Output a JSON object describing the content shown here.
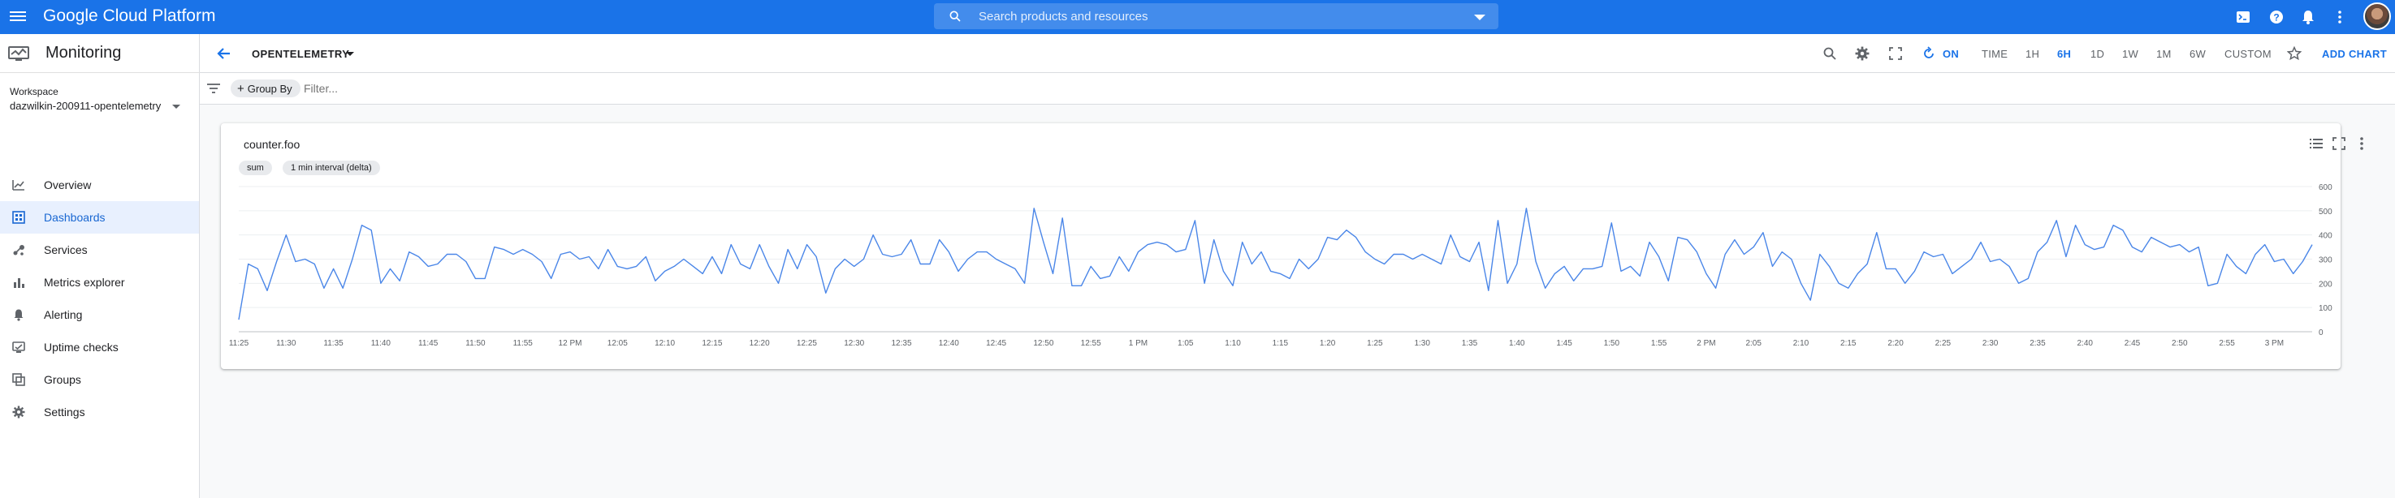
{
  "app": {
    "brand": "Google Cloud Platform"
  },
  "search": {
    "placeholder": "Search products and resources"
  },
  "sidebar": {
    "product": "Monitoring",
    "workspace_label": "Workspace",
    "workspace_value": "dazwilkin-200911-opentelemetry",
    "items": [
      {
        "label": "Overview",
        "icon": "overview-icon",
        "active": false
      },
      {
        "label": "Dashboards",
        "icon": "dashboards-icon",
        "active": true
      },
      {
        "label": "Services",
        "icon": "services-icon",
        "active": false
      },
      {
        "label": "Metrics explorer",
        "icon": "metrics-explorer-icon",
        "active": false
      },
      {
        "label": "Alerting",
        "icon": "bell-icon",
        "active": false
      },
      {
        "label": "Uptime checks",
        "icon": "uptime-icon",
        "active": false
      },
      {
        "label": "Groups",
        "icon": "groups-icon",
        "active": false
      },
      {
        "label": "Settings",
        "icon": "gear-icon",
        "active": false
      }
    ]
  },
  "toolbar": {
    "dashboard_name": "OPENTELEMETRY",
    "auto_refresh": "ON",
    "time_label": "TIME",
    "ranges": [
      "1H",
      "6H",
      "1D",
      "1W",
      "1M",
      "6W"
    ],
    "selected_range": "6H",
    "custom": "CUSTOM",
    "add_chart": "ADD CHART"
  },
  "filters": {
    "group_by": "Group By",
    "placeholder": "Filter..."
  },
  "colors": {
    "brand": "#1a73e8",
    "line": "#4a86e8",
    "active_bg": "#e8f0fe"
  },
  "chart": {
    "title": "counter.foo",
    "chips": [
      "sum",
      "1 min interval (delta)"
    ]
  },
  "chart_data": {
    "type": "line",
    "title": "counter.foo",
    "xlabel": "",
    "ylabel": "",
    "ylim": [
      0,
      600
    ],
    "yticks": [
      0,
      100,
      200,
      300,
      400,
      500,
      600
    ],
    "xticks": [
      "11:25",
      "11:30",
      "11:35",
      "11:40",
      "11:45",
      "11:50",
      "11:55",
      "12 PM",
      "12:05",
      "12:10",
      "12:15",
      "12:20",
      "12:25",
      "12:30",
      "12:35",
      "12:40",
      "12:45",
      "12:50",
      "12:55",
      "1 PM",
      "1:05",
      "1:10",
      "1:15",
      "1:20",
      "1:25",
      "1:30",
      "1:35",
      "1:40",
      "1:45",
      "1:50",
      "1:55",
      "2 PM",
      "2:05",
      "2:10",
      "2:15",
      "2:20",
      "2:25",
      "2:30",
      "2:35",
      "2:40",
      "2:45",
      "2:50",
      "2:55",
      "3 PM"
    ],
    "x_start": "11:25",
    "x_end": "3:00 PM",
    "x_step": "1 min",
    "grid": true,
    "series": [
      {
        "values": [
          50,
          280,
          260,
          170,
          290,
          400,
          290,
          300,
          280,
          180,
          260,
          180,
          300,
          440,
          420,
          200,
          260,
          210,
          330,
          310,
          270,
          280,
          320,
          320,
          290,
          220,
          220,
          350,
          340,
          320,
          340,
          320,
          290,
          220,
          320,
          330,
          300,
          310,
          260,
          340,
          270,
          260,
          270,
          310,
          210,
          250,
          270,
          300,
          270,
          240,
          310,
          240,
          360,
          280,
          260,
          360,
          270,
          200,
          340,
          260,
          360,
          310,
          160,
          260,
          300,
          270,
          300,
          400,
          320,
          310,
          320,
          380,
          280,
          280,
          380,
          330,
          250,
          300,
          330,
          330,
          300,
          280,
          260,
          200,
          510,
          370,
          240,
          470,
          190,
          190,
          270,
          220,
          230,
          310,
          250,
          330,
          360,
          370,
          360,
          330,
          340,
          460,
          200,
          380,
          250,
          190,
          370,
          280,
          330,
          250,
          240,
          220,
          300,
          260,
          300,
          390,
          380,
          420,
          390,
          330,
          300,
          280,
          320,
          320,
          300,
          320,
          300,
          280,
          400,
          310,
          290,
          370,
          170,
          460,
          200,
          280,
          510,
          290,
          180,
          240,
          270,
          210,
          260,
          260,
          270,
          450,
          250,
          270,
          230,
          370,
          310,
          210,
          390,
          380,
          330,
          240,
          180,
          320,
          380,
          320,
          350,
          410,
          270,
          330,
          300,
          200,
          130,
          320,
          270,
          200,
          180,
          240,
          280,
          410,
          260,
          260,
          200,
          250,
          330,
          310,
          320,
          240,
          270,
          300,
          370,
          290,
          300,
          270,
          200,
          220,
          330,
          370,
          460,
          310,
          440,
          360,
          340,
          350,
          440,
          420,
          350,
          330,
          390,
          370,
          350,
          360,
          330,
          350,
          190,
          200,
          320,
          270,
          240,
          320,
          360,
          290,
          300,
          240,
          290,
          360
        ]
      }
    ]
  }
}
